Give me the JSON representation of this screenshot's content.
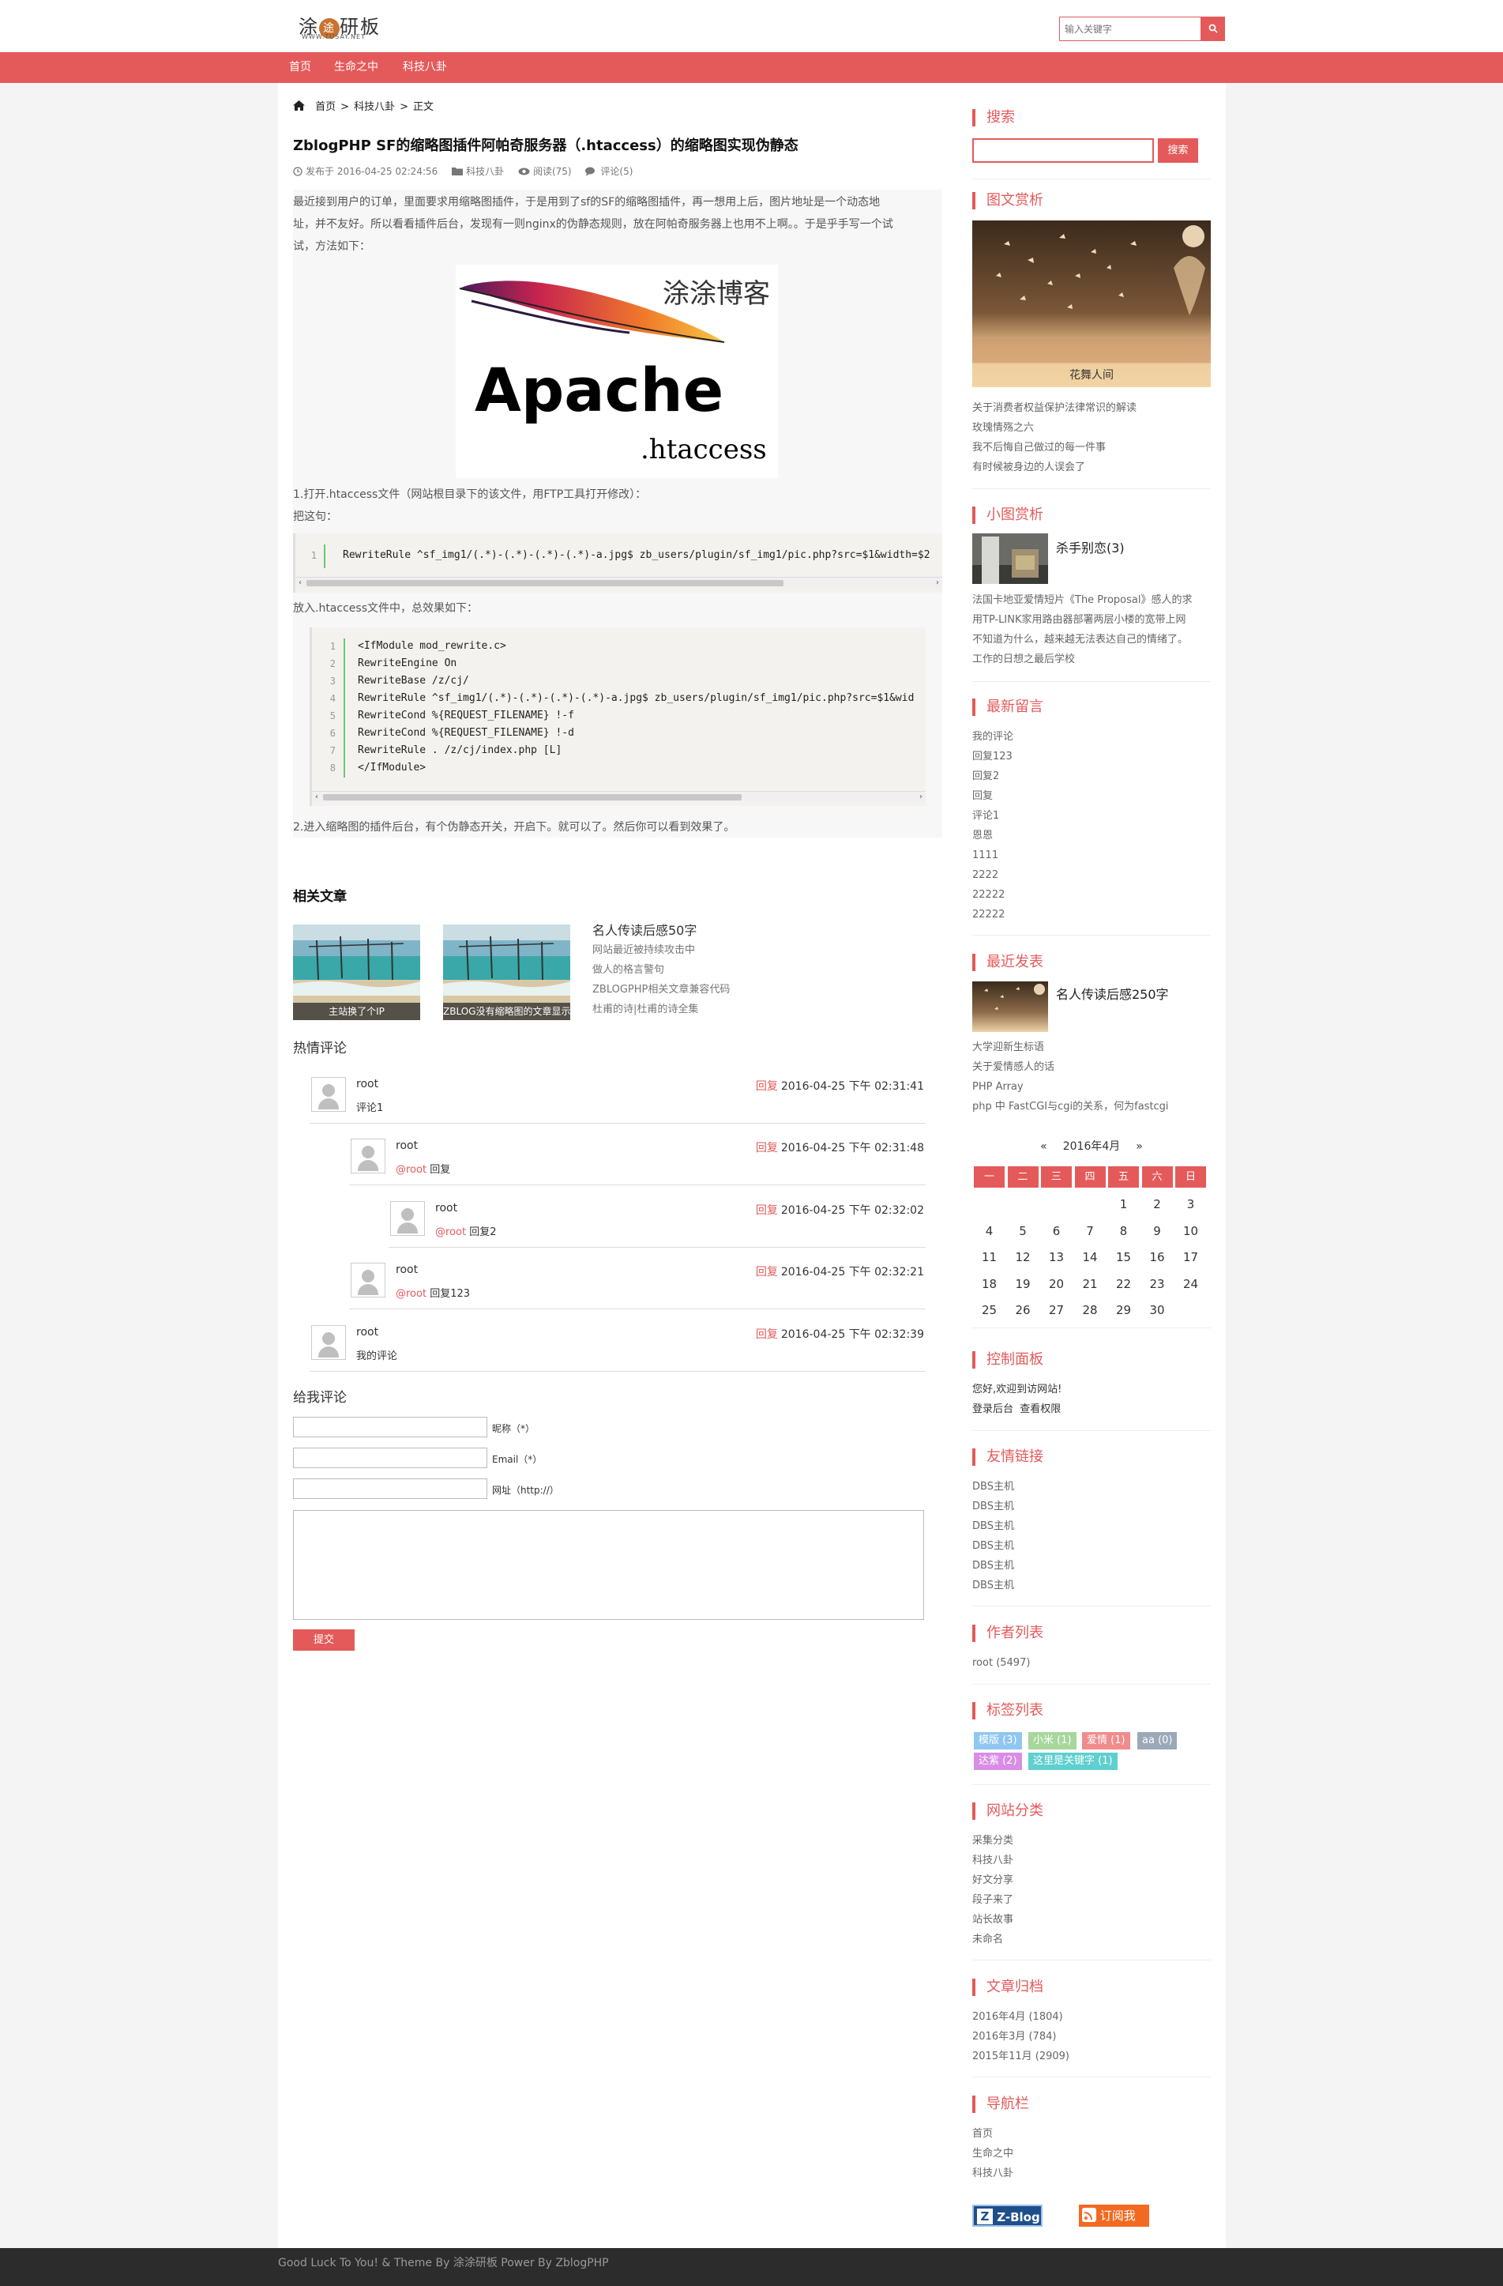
{
  "header": {
    "logo_text": "涂",
    "logo_mid": "途",
    "logo_text2": "研板",
    "logo_sub": "WWW.TUSAY.NET",
    "search_placeholder": "输入关键字"
  },
  "nav": [
    "首页",
    "生命之中",
    "科技八卦"
  ],
  "breadcrumb": {
    "home": "首页",
    "sep": ">",
    "category": "科技八卦",
    "current": "正文"
  },
  "article": {
    "title": "ZblogPHP SF的缩略图插件阿帕奇服务器（.htaccess）的缩略图实现伪静态",
    "meta": {
      "date": "发布于 2016-04-25 02:24:56",
      "category": "科技八卦",
      "views": "阅读(75)",
      "comments": "评论(5)"
    },
    "intro_lines": [
      "最近接到用户的订单，里面要求用缩略图插件，于是用到了sf的SF的缩略图插件，再一想用上后，图片地址是一个动态地",
      "址，并不友好。所以看看插件后台，发现有一则nginx的伪静态规则，放在阿帕奇服务器上也用不上啊。。于是乎手写一个试",
      "试，方法如下："
    ],
    "image": {
      "title": "涂涂博客",
      "brand": "Apache",
      "ext": ".htaccess"
    },
    "step1": "1.打开.htaccess文件（网站根目录下的该文件，用FTP工具打开修改）：",
    "step1b": "把这句：",
    "code1": [
      {
        "no": "1",
        "line": "RewriteRule ^sf_img1/(.*)-(.*)-(.*)-(.*)-a.jpg$ zb_users/plugin/sf_img1/pic.php?src=$1&width=$2"
      }
    ],
    "after_code1": "放入.htaccess文件中，总效果如下：",
    "code2": [
      {
        "no": "1",
        "line": "<IfModule mod_rewrite.c>"
      },
      {
        "no": "2",
        "line": "RewriteEngine On"
      },
      {
        "no": "3",
        "line": "RewriteBase /z/cj/"
      },
      {
        "no": "4",
        "line": "RewriteRule ^sf_img1/(.*)-(.*)-(.*)-(.*)-a.jpg$ zb_users/plugin/sf_img1/pic.php?src=$1&wid"
      },
      {
        "no": "5",
        "line": "RewriteCond %{REQUEST_FILENAME} !-f"
      },
      {
        "no": "6",
        "line": "RewriteCond %{REQUEST_FILENAME} !-d"
      },
      {
        "no": "7",
        "line": "RewriteRule . /z/cj/index.php [L]"
      },
      {
        "no": "8",
        "line": "</IfModule>"
      }
    ],
    "step2": "2.进入缩略图的插件后台，有个伪静态开关，开启下。就可以了。然后你可以看到效果了。"
  },
  "related": {
    "heading": "相关文章",
    "thumbs": [
      {
        "caption": "主站换了个IP"
      },
      {
        "caption": "ZBLOG没有缩略图的文章显示"
      }
    ],
    "list": [
      "名人传读后感50字",
      "网站最近被持续攻击中",
      "做人的格言警句",
      "ZBLOGPHP相关文章兼容代码",
      "杜甫的诗|杜甫的诗全集"
    ]
  },
  "comments": {
    "heading": "热情评论",
    "reply_label": "回复",
    "items": [
      {
        "name": "root",
        "text": "评论1",
        "at": "",
        "date": "2016-04-25 下午 02:31:41"
      },
      {
        "name": "root",
        "text": "回复",
        "at": "@root",
        "date": "2016-04-25 下午 02:31:48"
      },
      {
        "name": "root",
        "text": "回复2",
        "at": "@root",
        "date": "2016-04-25 下午 02:32:02"
      },
      {
        "name": "root",
        "text": "回复123",
        "at": "@root",
        "date": "2016-04-25 下午 02:32:21"
      },
      {
        "name": "root",
        "text": "我的评论",
        "at": "",
        "date": "2016-04-25 下午 02:32:39"
      }
    ]
  },
  "form": {
    "heading": "给我评论",
    "name_label": "昵称（*）",
    "email_label": "Email（*）",
    "url_label": "网址（http://）",
    "submit": "提交"
  },
  "sidebar": {
    "search": {
      "title": "搜索",
      "button": "搜索"
    },
    "gallery": {
      "title": "图文赏析",
      "caption": "花舞人间",
      "list": [
        "关于消费者权益保护法律常识的解读",
        "玫瑰情殇之六",
        "我不后悔自己做过的每一件事",
        "有时候被身边的人误会了"
      ]
    },
    "small": {
      "title": "小图赏析",
      "post": "杀手别恋(3)",
      "list": [
        "法国卡地亚爱情短片《The Proposal》感人的求",
        "用TP-LINK家用路由器部署两层小楼的宽带上网",
        "不知道为什么，越来越无法表达自己的情绪了。",
        "工作的日想之最后学校"
      ]
    },
    "recent_comments": {
      "title": "最新留言",
      "list": [
        "我的评论",
        "回复123",
        "回复2",
        "回复",
        "评论1",
        "恩恩",
        "1111",
        "2222",
        "22222",
        "22222"
      ]
    },
    "recent_posts": {
      "title": "最近发表",
      "post": "名人传读后感250字",
      "list": [
        "大学迎新生标语",
        "关于爱情感人的话",
        "PHP Array",
        "php 中 FastCGI与cgi的关系，何为fastcgi"
      ]
    },
    "calendar": {
      "prev": "«",
      "month": "2016年4月",
      "next": "»",
      "days": [
        "一",
        "二",
        "三",
        "四",
        "五",
        "六",
        "日"
      ],
      "weeks": [
        [
          "",
          "",
          "",
          "",
          "1",
          "2",
          "3"
        ],
        [
          "4",
          "5",
          "6",
          "7",
          "8",
          "9",
          "10"
        ],
        [
          "11",
          "12",
          "13",
          "14",
          "15",
          "16",
          "17"
        ],
        [
          "18",
          "19",
          "20",
          "21",
          "22",
          "23",
          "24"
        ],
        [
          "25",
          "26",
          "27",
          "28",
          "29",
          "30",
          ""
        ]
      ]
    },
    "control": {
      "title": "控制面板",
      "welcome": "您好,欢迎到访网站!",
      "admin": "登录后台",
      "perm": "查看权限"
    },
    "links": {
      "title": "友情链接",
      "list": [
        "DBS主机",
        "DBS主机",
        "DBS主机",
        "DBS主机",
        "DBS主机",
        "DBS主机"
      ]
    },
    "authors": {
      "title": "作者列表",
      "list": [
        "root (5497)"
      ]
    },
    "tags": {
      "title": "标签列表",
      "items": [
        {
          "label": "模版 (3)",
          "color": "#8fc7f0"
        },
        {
          "label": "小米 (1)",
          "color": "#a7d79b"
        },
        {
          "label": "爱情 (1)",
          "color": "#f08c8c"
        },
        {
          "label": "aa (0)",
          "color": "#9aa8b8"
        },
        {
          "label": "达紫 (2)",
          "color": "#d98de6"
        },
        {
          "label": "这里是关键字 (1)",
          "color": "#5fcfcf"
        }
      ]
    },
    "categories": {
      "title": "网站分类",
      "list": [
        "采集分类",
        "科技八卦",
        "好文分享",
        "段子来了",
        "站长故事",
        "未命名"
      ]
    },
    "archives": {
      "title": "文章归档",
      "list": [
        "2016年4月 (1804)",
        "2016年3月 (784)",
        "2015年11月 (2909)"
      ]
    },
    "navbar": {
      "title": "导航栏",
      "list": [
        "首页",
        "生命之中",
        "科技八卦"
      ]
    },
    "badges": {
      "zblog": "Z-Blog",
      "rss": "订阅我"
    }
  },
  "footer": "Good Luck To You! & Theme By 涂涂研板 Power By ZblogPHP"
}
